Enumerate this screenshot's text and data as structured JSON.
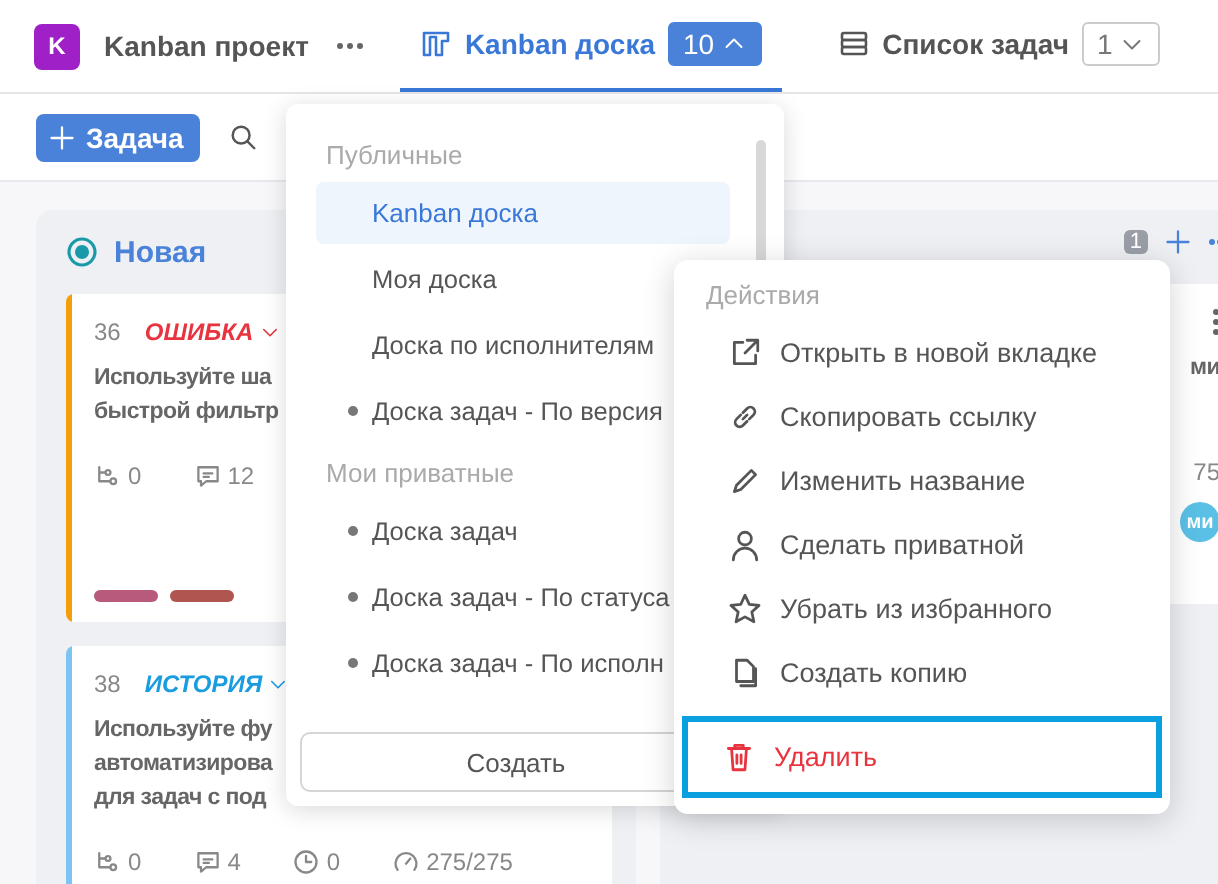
{
  "header": {
    "project_initial": "K",
    "project_name": "Kanban проект",
    "tabs": [
      {
        "kind": "board",
        "label": "Kanban доска",
        "count": "10",
        "selected": true,
        "expanded": true
      },
      {
        "kind": "list",
        "label": "Список задач",
        "count": "1",
        "selected": false,
        "expanded": false
      }
    ]
  },
  "toolbar": {
    "add_button": "Задача"
  },
  "columns": [
    {
      "title": "Новая",
      "cards": [
        {
          "number": "36",
          "type": "ОШИБКА",
          "color": "#e8343f",
          "stripe": {
            "color": "#f59e0b"
          },
          "title_lines": [
            "Используйте ша",
            "быстрой фильтр"
          ],
          "stats": [
            {
              "kind": "subtasks",
              "value": "0"
            },
            {
              "kind": "comments",
              "value": "12"
            }
          ],
          "tags": [
            {
              "color": "#b85a7c"
            },
            {
              "color": "#b05550"
            }
          ]
        },
        {
          "number": "38",
          "type": "ИСТОРИЯ",
          "color": "#1a9ce0",
          "stripe": {
            "color": "#7cc4f4"
          },
          "title_lines": [
            "Используйте фу",
            "автоматизирова",
            "для задач с под"
          ],
          "stats": [
            {
              "kind": "subtasks",
              "value": "0"
            },
            {
              "kind": "comments",
              "value": "4"
            },
            {
              "kind": "time",
              "value": "0"
            },
            {
              "kind": "estimate",
              "value": "275/275"
            }
          ]
        }
      ]
    },
    {
      "count": "1",
      "cards": [
        {
          "title": "ми",
          "stat": "75",
          "avatar": "ми"
        }
      ]
    }
  ],
  "boards_dropdown": {
    "sections": [
      {
        "title": "Публичные",
        "items": [
          {
            "label": "Kanban доска",
            "selected": true,
            "marker": false
          },
          {
            "label": "Моя доска",
            "selected": false,
            "marker": false
          },
          {
            "label": "Доска по исполнителям",
            "selected": false,
            "marker": false
          },
          {
            "label": "Доска задач - По версия",
            "selected": false,
            "marker": true
          }
        ]
      },
      {
        "title": "Мои приватные",
        "items": [
          {
            "label": "Доска задач",
            "selected": false,
            "marker": true
          },
          {
            "label": "Доска задач - По статуса",
            "selected": false,
            "marker": true
          },
          {
            "label": "Доска задач - По исполн",
            "selected": false,
            "marker": true
          }
        ]
      }
    ],
    "create_button": "Создать"
  },
  "actions_menu": {
    "title": "Действия",
    "items": [
      {
        "kind": "external",
        "label": "Открыть в новой вкладке",
        "danger": false,
        "highlighted": false
      },
      {
        "kind": "link",
        "label": "Скопировать ссылку",
        "danger": false,
        "highlighted": false
      },
      {
        "kind": "pencil",
        "label": "Изменить название",
        "danger": false,
        "highlighted": false
      },
      {
        "kind": "person",
        "label": "Сделать приватной",
        "danger": false,
        "highlighted": false
      },
      {
        "kind": "star",
        "label": "Убрать из избранного",
        "danger": false,
        "highlighted": false
      },
      {
        "kind": "copy",
        "label": "Создать копию",
        "danger": false,
        "highlighted": false
      },
      {
        "kind": "trash",
        "label": "Удалить",
        "danger": true,
        "highlighted": true
      }
    ]
  }
}
